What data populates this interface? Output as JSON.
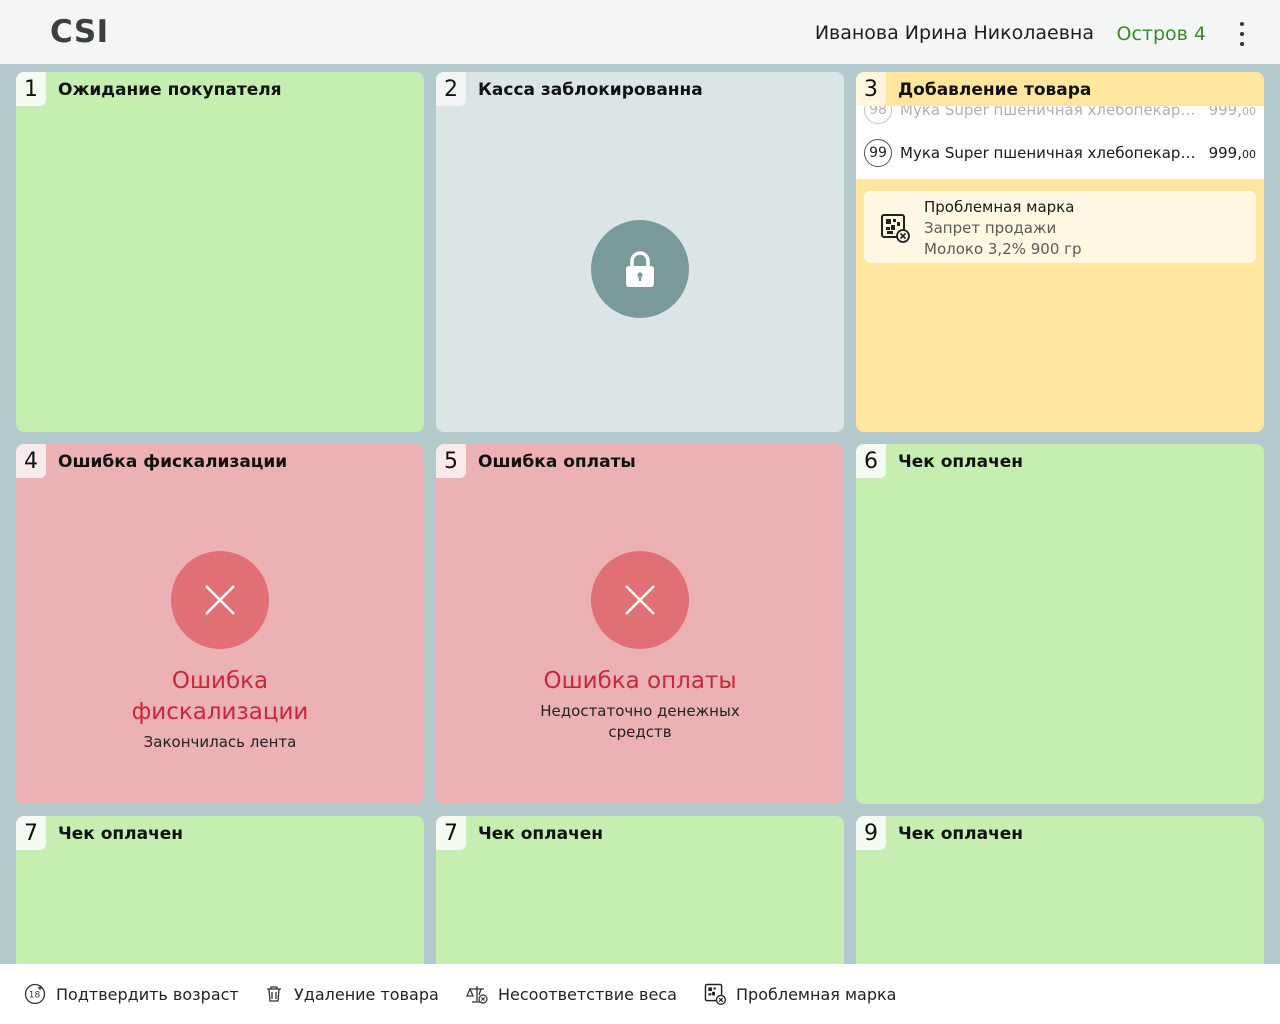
{
  "header": {
    "logo": "CSI",
    "user_name": "Иванова Ирина Николаевна",
    "island": "Остров 4",
    "accent_color": "#3a8a2a"
  },
  "tiles": [
    {
      "num": "1",
      "title": "Ожидание покупателя",
      "status": "green"
    },
    {
      "num": "2",
      "title": "Касса заблокированна",
      "status": "gray"
    },
    {
      "num": "3",
      "title": "Добавление товара",
      "status": "yellow",
      "items": [
        {
          "num": "98",
          "name": "Мука Super пшеничная хлебопекарная",
          "price_int": "999,",
          "price_dec": "00"
        },
        {
          "num": "99",
          "name": "Мука Super пшеничная хлебопекарная",
          "price_int": "999,",
          "price_dec": "00"
        }
      ],
      "problem": {
        "title": "Проблемная марка",
        "reason": "Запрет продажи",
        "product": "Молоко 3,2% 900 гр"
      }
    },
    {
      "num": "4",
      "title": "Ошибка фискализации",
      "status": "red",
      "error_title_line1": "Ошибка",
      "error_title_line2": "фискализации",
      "error_sub": "Закончилась лента"
    },
    {
      "num": "5",
      "title": "Ошибка оплаты",
      "status": "red",
      "error_title_line1": "Ошибка оплаты",
      "error_sub_line1": "Недостаточно денежных",
      "error_sub_line2": "средств"
    },
    {
      "num": "6",
      "title": "Чек оплачен",
      "status": "green"
    },
    {
      "num": "7",
      "title": "Чек оплачен",
      "status": "green"
    },
    {
      "num": "7",
      "title": "Чек оплачен",
      "status": "green"
    },
    {
      "num": "9",
      "title": "Чек оплачен",
      "status": "green"
    }
  ],
  "bottom_bar": {
    "confirm_age": "Подтвердить возраст",
    "confirm_age_badge": "18",
    "delete_item": "Удаление товара",
    "weight_mismatch": "Несоответствие веса",
    "problem_mark": "Проблемная марка"
  },
  "colors": {
    "background": "#b4c9cb",
    "green": "#c5eeb0",
    "gray": "#dbe5e6",
    "yellow": "#fee69e",
    "red": "#ecb1b5",
    "error_text": "#c8283a"
  }
}
